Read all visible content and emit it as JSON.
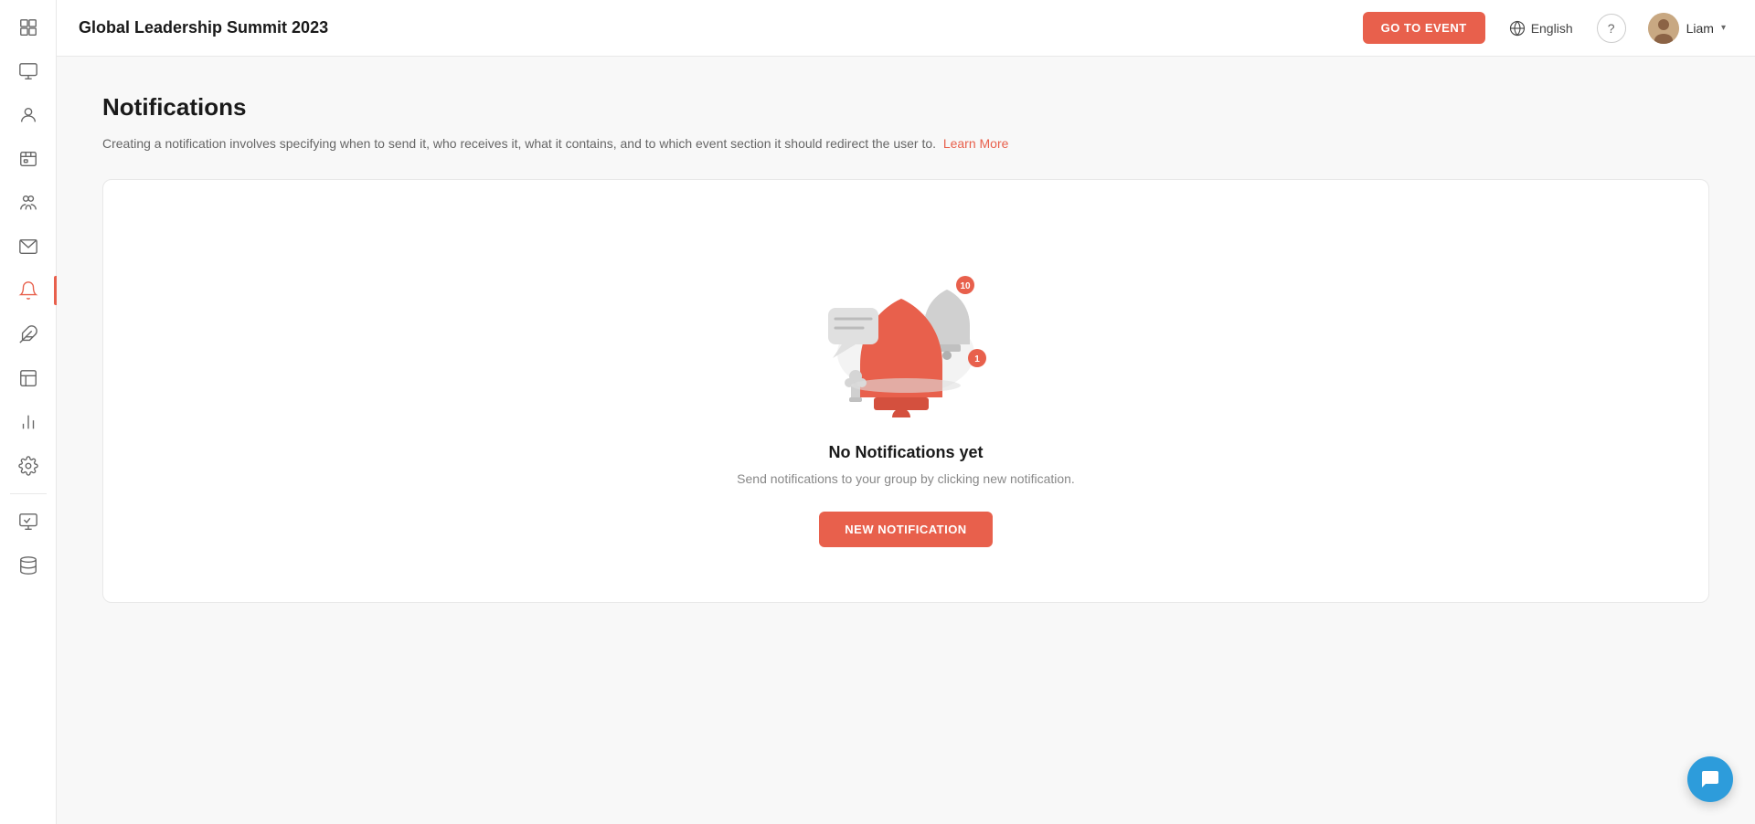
{
  "header": {
    "title": "Global Leadership Summit 2023",
    "go_to_event_label": "GO TO EVENT",
    "language": "English",
    "user_name": "Liam"
  },
  "page": {
    "title": "Notifications",
    "description": "Creating a notification involves specifying when to send it, who receives it, what it contains, and to which event section it should redirect the user to.",
    "learn_more_label": "Learn More",
    "empty_title": "No Notifications yet",
    "empty_subtitle": "Send notifications to your group by clicking new notification.",
    "new_notification_label": "NEW NOTIFICATION"
  },
  "sidebar": {
    "items": [
      {
        "name": "dashboard",
        "icon": "grid"
      },
      {
        "name": "screen",
        "icon": "monitor"
      },
      {
        "name": "person",
        "icon": "person"
      },
      {
        "name": "sessions",
        "icon": "sessions"
      },
      {
        "name": "team",
        "icon": "team"
      },
      {
        "name": "email",
        "icon": "email"
      },
      {
        "name": "notifications",
        "icon": "bell",
        "active": true
      },
      {
        "name": "puzzle",
        "icon": "puzzle"
      },
      {
        "name": "layout",
        "icon": "layout"
      },
      {
        "name": "analytics",
        "icon": "bar-chart"
      },
      {
        "name": "settings",
        "icon": "settings"
      },
      {
        "name": "monitor-bottom",
        "icon": "monitor2"
      },
      {
        "name": "database",
        "icon": "database"
      }
    ]
  }
}
